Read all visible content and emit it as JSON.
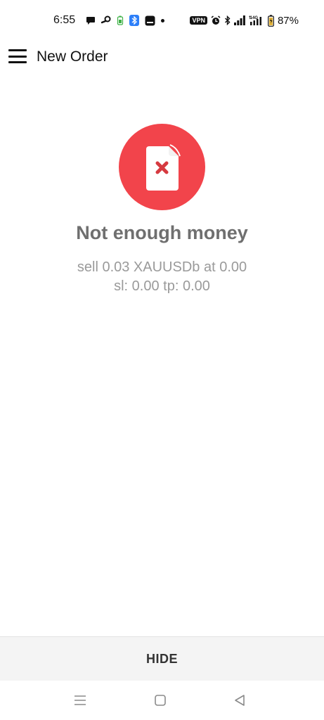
{
  "status_bar": {
    "time": "6:55",
    "battery_percent": "87%",
    "vpn_label": "VPN",
    "network_label": "4G"
  },
  "app_bar": {
    "title": "New Order"
  },
  "error": {
    "title": "Not enough money",
    "detail_line1": "sell 0.03 XAUUSDb at 0.00",
    "detail_line2": "sl: 0.00 tp: 0.00",
    "icon": "document-error-icon",
    "accent_color": "#f2444b"
  },
  "actions": {
    "hide_label": "HIDE"
  },
  "nav": {
    "icons": [
      "recents-icon",
      "home-icon",
      "back-icon"
    ]
  }
}
